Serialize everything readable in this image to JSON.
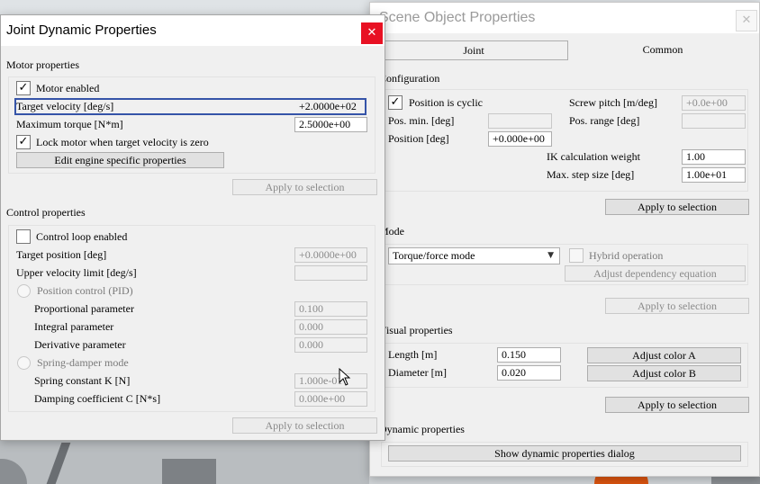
{
  "scene_window": {
    "title": "Scene Object Properties",
    "close_glyph": "✕",
    "tabs": [
      {
        "label": "Joint"
      },
      {
        "label": "Common"
      }
    ],
    "configuration": {
      "label": "Configuration",
      "position_cyclic_label": "Position is cyclic",
      "position_cyclic_checked": true,
      "screw_pitch_label": "Screw pitch [m/deg]",
      "screw_pitch_value": "+0.0e+00",
      "pos_min_label": "Pos. min. [deg]",
      "pos_min_value": "",
      "pos_range_label": "Pos. range [deg]",
      "pos_range_value": "",
      "position_label": "Position [deg]",
      "position_value": "+0.000e+00",
      "ik_weight_label": "IK calculation weight",
      "ik_weight_value": "1.00",
      "max_step_label": "Max. step size [deg]",
      "max_step_value": "1.00e+01",
      "apply_label": "Apply to selection"
    },
    "mode": {
      "label": "Mode",
      "selected": "Torque/force mode",
      "hybrid_label": "Hybrid operation",
      "adjust_dep_label": "Adjust dependency equation",
      "apply_label": "Apply to selection"
    },
    "visual": {
      "label": "Visual properties",
      "length_label": "Length [m]",
      "length_value": "0.150",
      "diameter_label": "Diameter [m]",
      "diameter_value": "0.020",
      "color_a_label": "Adjust color A",
      "color_b_label": "Adjust color B",
      "apply_label": "Apply to selection"
    },
    "dynamic": {
      "label": "Dynamic properties",
      "show_dialog_label": "Show dynamic properties dialog"
    }
  },
  "joint_window": {
    "title": "Joint Dynamic Properties",
    "close_glyph": "✕",
    "motor": {
      "label": "Motor properties",
      "motor_enabled_label": "Motor enabled",
      "motor_enabled_checked": true,
      "target_velocity_label": "Target velocity [deg/s]",
      "target_velocity_value": "+2.0000e+02",
      "max_torque_label": "Maximum torque [N*m]",
      "max_torque_value": "2.5000e+00",
      "lock_motor_label": "Lock motor when target velocity is zero",
      "lock_motor_checked": true,
      "edit_engine_label": "Edit engine specific properties",
      "apply_label": "Apply to selection"
    },
    "control": {
      "label": "Control properties",
      "control_loop_label": "Control loop enabled",
      "control_loop_checked": false,
      "target_position_label": "Target position [deg]",
      "target_position_value": "+0.0000e+00",
      "upper_velocity_label": "Upper velocity limit [deg/s]",
      "upper_velocity_value": "",
      "position_control_label": "Position control (PID)",
      "proportional_label": "Proportional parameter",
      "proportional_value": "0.100",
      "integral_label": "Integral parameter",
      "integral_value": "0.000",
      "derivative_label": "Derivative parameter",
      "derivative_value": "0.000",
      "spring_damper_label": "Spring-damper mode",
      "spring_k_label": "Spring constant K [N]",
      "spring_k_value": "1.000e-01",
      "damping_label": "Damping coefficient C [N*s]",
      "damping_value": "0.000e+00",
      "apply_label": "Apply to selection"
    }
  },
  "colors": {
    "close_red": "#e81123",
    "selection_blue": "#3554a8",
    "scene_orange": "#d9530f"
  }
}
